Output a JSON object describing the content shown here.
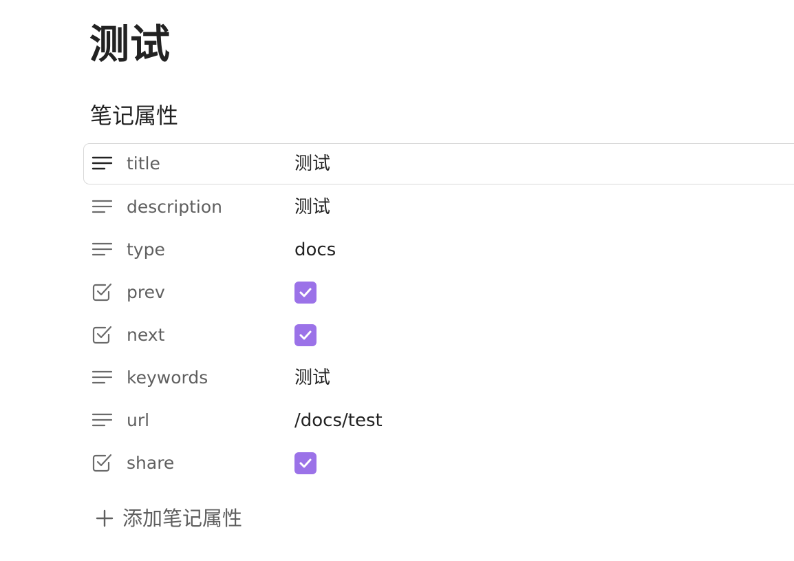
{
  "page": {
    "title": "测试"
  },
  "properties": {
    "heading": "笔记属性",
    "items": [
      {
        "key": "title",
        "kind": "text",
        "icon": "text-lines-icon",
        "value": "测试"
      },
      {
        "key": "description",
        "kind": "text",
        "icon": "text-lines-icon",
        "value": "测试"
      },
      {
        "key": "type",
        "kind": "text",
        "icon": "text-lines-icon",
        "value": "docs"
      },
      {
        "key": "prev",
        "kind": "checkbox",
        "icon": "checkbox-icon",
        "checked": true
      },
      {
        "key": "next",
        "kind": "checkbox",
        "icon": "checkbox-icon",
        "checked": true
      },
      {
        "key": "keywords",
        "kind": "text",
        "icon": "text-lines-icon",
        "value": "测试"
      },
      {
        "key": "url",
        "kind": "text",
        "icon": "text-lines-icon",
        "value": "/docs/test"
      },
      {
        "key": "share",
        "kind": "checkbox",
        "icon": "checkbox-icon",
        "checked": true
      }
    ],
    "add_label": "添加笔记属性",
    "add_icon": "plus-icon"
  },
  "colors": {
    "accent": "#9b72e8",
    "text": "#222222",
    "muted": "#5f5f5f",
    "border": "#d9d9d9"
  }
}
